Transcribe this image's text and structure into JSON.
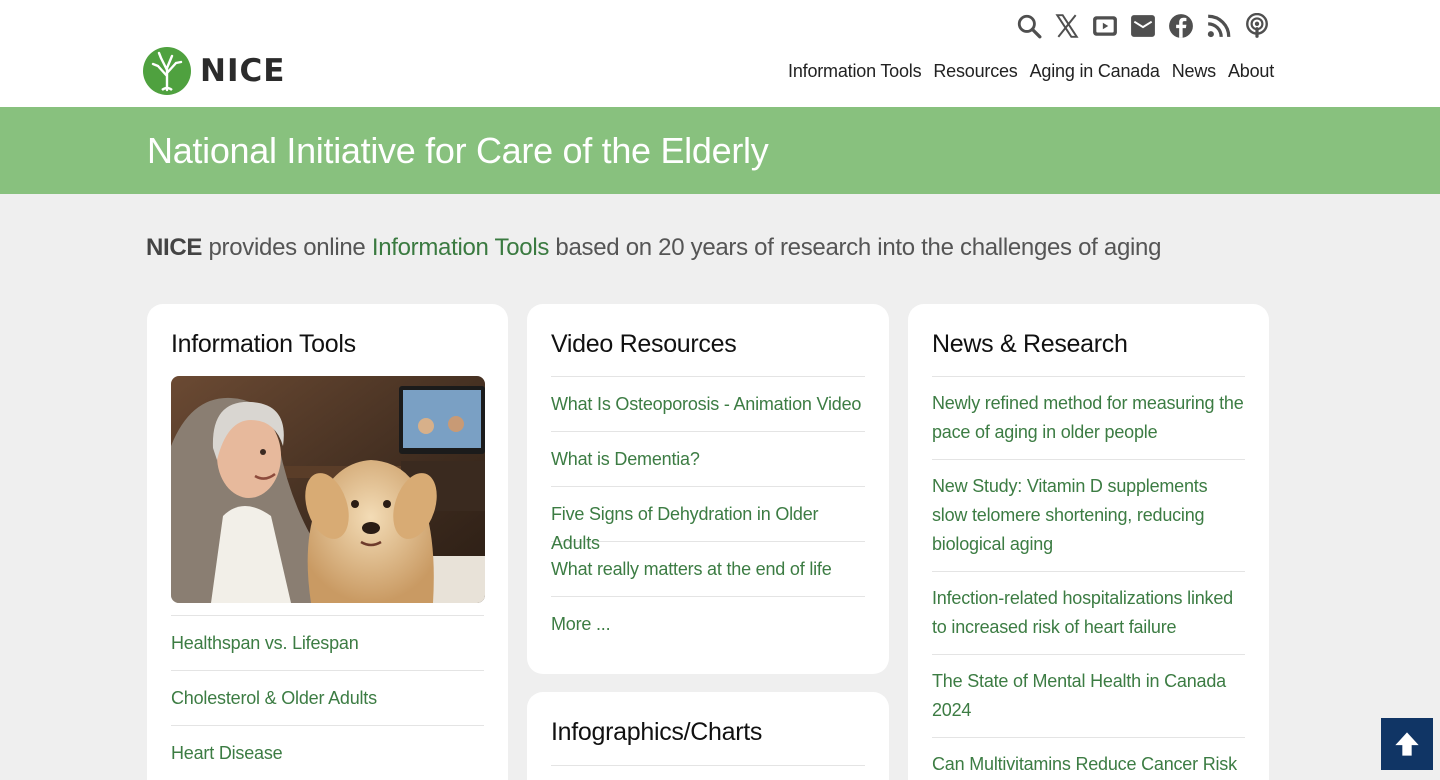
{
  "brand": {
    "name": "NICE"
  },
  "social_icons": [
    "search-icon",
    "x-twitter-icon",
    "youtube-icon",
    "email-icon",
    "facebook-icon",
    "rss-icon",
    "podcast-icon"
  ],
  "nav": [
    "Information Tools",
    "Resources",
    "Aging in Canada",
    "News",
    "About"
  ],
  "banner": {
    "title": "National Initiative for Care of the Elderly"
  },
  "intro": {
    "bold": "NICE",
    "text1": " provides online ",
    "link": "Information Tools",
    "text2": " based on 20 years of research into the challenges of aging"
  },
  "cards": {
    "information_tools": {
      "title": "Information Tools",
      "image": "elderly-woman-with-golden-retriever-photo",
      "items": [
        "Healthspan vs. Lifespan",
        "Cholesterol & Older Adults",
        "Heart Disease"
      ]
    },
    "video_resources": {
      "title": "Video Resources",
      "items": [
        "What Is Osteoporosis - Animation Video",
        "What is Dementia?",
        "Five Signs of Dehydration in Older Adults",
        "What really matters at the end of life",
        "More ..."
      ]
    },
    "infographics": {
      "title": "Infographics/Charts"
    },
    "news_research": {
      "title": "News & Research",
      "items": [
        "Newly refined method for measuring the pace of aging in older people",
        "New Study: Vitamin D supplements slow telomere shortening, reducing biological aging",
        "Infection-related hospitalizations linked to increased risk of heart failure",
        "The State of Mental Health in Canada 2024",
        "Can Multivitamins Reduce Cancer Risk"
      ]
    }
  },
  "colors": {
    "banner": "#88c17e",
    "link": "#3c7c43",
    "back_to_top": "#103565"
  }
}
